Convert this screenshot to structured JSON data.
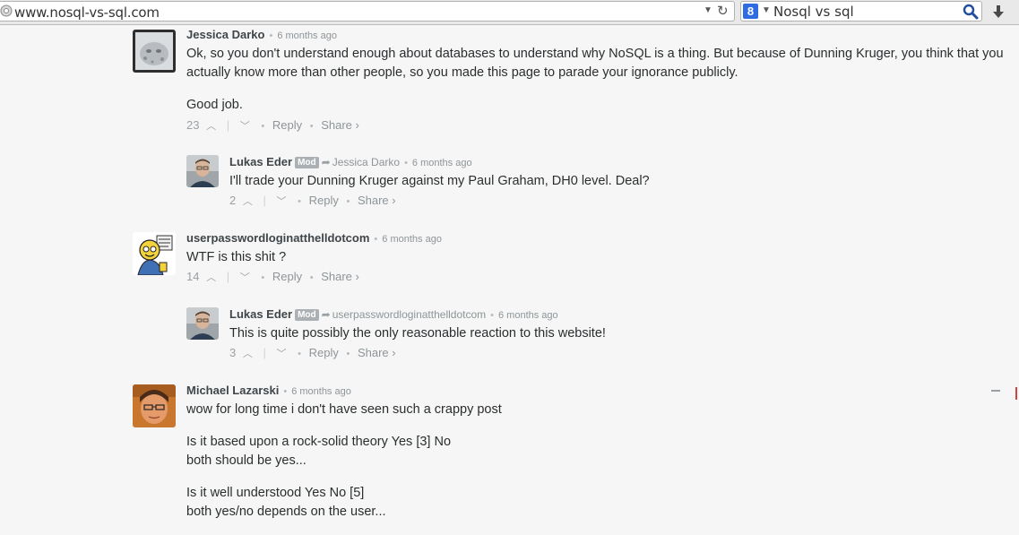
{
  "browser": {
    "url": "www.nosql-vs-sql.com",
    "search_query": "Nosql vs sql",
    "engine_letter": "8"
  },
  "comments": [
    {
      "author": "Jessica Darko",
      "time": "6 months ago",
      "body": [
        "Ok, so you don't understand enough about databases to understand why NoSQL is a thing. But because of Dunning Kruger, you think that you actually know more than other people, so you made this page to parade your ignorance publicly.",
        "Good job."
      ],
      "votes": "23",
      "reply_label": "Reply",
      "share_label": "Share ›"
    },
    {
      "author": "Lukas Eder",
      "badge": "Mod",
      "reply_to": "Jessica Darko",
      "time": "6 months ago",
      "body": [
        "I'll trade your Dunning Kruger against my Paul Graham, DH0 level. Deal?"
      ],
      "votes": "2",
      "reply_label": "Reply",
      "share_label": "Share ›"
    },
    {
      "author": "userpasswordloginatthelldotcom",
      "time": "6 months ago",
      "body": [
        "WTF is this shit ?"
      ],
      "votes": "14",
      "reply_label": "Reply",
      "share_label": "Share ›"
    },
    {
      "author": "Lukas Eder",
      "badge": "Mod",
      "reply_to": "userpasswordloginatthelldotcom",
      "time": "6 months ago",
      "body": [
        "This is quite possibly the only reasonable reaction to this website!"
      ],
      "votes": "3",
      "reply_label": "Reply",
      "share_label": "Share ›"
    },
    {
      "author": "Michael Lazarski",
      "time": "6 months ago",
      "body": [
        "wow for long time i don't have seen such a crappy post",
        "Is it based upon a rock-solid theory Yes [3] No",
        "both should be yes...",
        "Is it well understood Yes No [5]",
        "both yes/no depends on the user..."
      ]
    }
  ],
  "icons": {
    "url_icon": "globe-icon",
    "reload": "reload-icon",
    "search_go": "magnifier-icon",
    "download": "download-arrow-icon",
    "upvote": "chevron-up-icon",
    "downvote": "chevron-down-icon",
    "reply_arrow": "reply-arrow-icon",
    "collapse": "collapse-icon"
  },
  "colors": {
    "background": "#f6f6f6",
    "text": "#2a2e2e",
    "muted": "#8e9599",
    "mod_badge": "#aab0b4",
    "engine_blue": "#2f6be1"
  }
}
